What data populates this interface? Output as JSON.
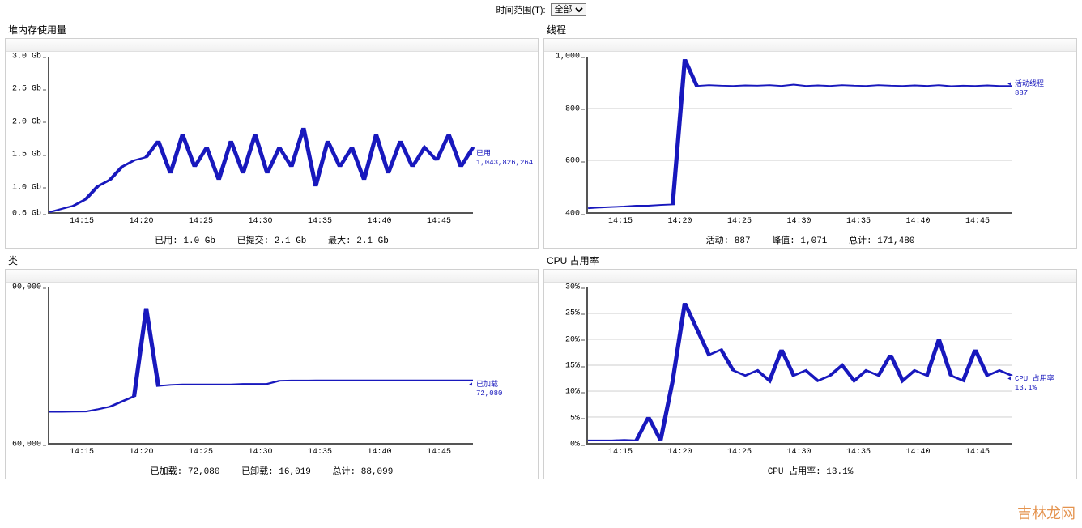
{
  "time_range_label": "时间范围(T):",
  "time_range_value": "全部",
  "watermark": "吉林龙网",
  "x_labels": [
    "14:15",
    "14:20",
    "14:25",
    "14:30",
    "14:35",
    "14:40",
    "14:45"
  ],
  "panels": {
    "heap": {
      "title": "堆内存使用量",
      "y_ticks": [
        "0.6 Gb",
        "1.0 Gb",
        "1.5 Gb",
        "2.0 Gb",
        "2.5 Gb",
        "3.0 Gb"
      ],
      "series_label_name": "已用",
      "series_label_value": "1,043,826,264",
      "summary": {
        "used": "已用:  1.0  Gb",
        "committed": "已提交:  2.1  Gb",
        "max": "最大:  2.1  Gb"
      }
    },
    "threads": {
      "title": "线程",
      "y_ticks": [
        "400",
        "600",
        "800",
        "1,000"
      ],
      "series_label_name": "活动线程",
      "series_label_value": "887",
      "summary": {
        "active": "活动:  887",
        "peak": "峰值:  1,071",
        "total": "总计:  171,480"
      }
    },
    "classes": {
      "title": "类",
      "y_ticks": [
        "60,000",
        "90,000"
      ],
      "series_label_name": "已加载",
      "series_label_value": "72,080",
      "summary": {
        "loaded": "已加载:  72,080",
        "unloaded": "已卸载:  16,019",
        "total": "总计:  88,099"
      }
    },
    "cpu": {
      "title": "CPU 占用率",
      "y_ticks": [
        "0%",
        "5%",
        "10%",
        "15%",
        "20%",
        "25%",
        "30%"
      ],
      "series_label_name": "CPU 占用率",
      "series_label_value": "13.1%",
      "summary": {
        "usage": "CPU 占用率:  13.1%"
      }
    }
  },
  "chart_data": [
    {
      "id": "heap",
      "type": "line",
      "title": "堆内存使用量",
      "xlabel": "",
      "ylabel": "",
      "ylim_gb": [
        0.6,
        3.0
      ],
      "x": [
        "14:12",
        "14:13",
        "14:14",
        "14:15",
        "14:16",
        "14:17",
        "14:18",
        "14:19",
        "14:20",
        "14:21",
        "14:22",
        "14:23",
        "14:24",
        "14:25",
        "14:26",
        "14:27",
        "14:28",
        "14:29",
        "14:30",
        "14:31",
        "14:32",
        "14:33",
        "14:34",
        "14:35",
        "14:36",
        "14:37",
        "14:38",
        "14:39",
        "14:40",
        "14:41",
        "14:42",
        "14:43",
        "14:44",
        "14:45",
        "14:46",
        "14:47"
      ],
      "series": [
        {
          "name": "已用 (bytes)",
          "values_gb": [
            0.6,
            0.65,
            0.7,
            0.8,
            1.0,
            1.1,
            1.3,
            1.4,
            1.45,
            1.7,
            1.2,
            1.8,
            1.3,
            1.6,
            1.1,
            1.7,
            1.2,
            1.8,
            1.2,
            1.6,
            1.3,
            1.9,
            1.0,
            1.7,
            1.3,
            1.6,
            1.1,
            1.8,
            1.2,
            1.7,
            1.3,
            1.6,
            1.4,
            1.8,
            1.3,
            1.6
          ],
          "current_bytes": 1043826264
        }
      ],
      "summary": {
        "used_gb": 1.0,
        "committed_gb": 2.1,
        "max_gb": 2.1
      }
    },
    {
      "id": "threads",
      "type": "line",
      "title": "线程",
      "ylim": [
        400,
        1000
      ],
      "x": [
        "14:12",
        "14:13",
        "14:14",
        "14:15",
        "14:16",
        "14:17",
        "14:18",
        "14:19",
        "14:20",
        "14:21",
        "14:22",
        "14:23",
        "14:24",
        "14:25",
        "14:26",
        "14:27",
        "14:28",
        "14:29",
        "14:30",
        "14:31",
        "14:32",
        "14:33",
        "14:34",
        "14:35",
        "14:36",
        "14:37",
        "14:38",
        "14:39",
        "14:40",
        "14:41",
        "14:42",
        "14:43",
        "14:44",
        "14:45",
        "14:46",
        "14:47"
      ],
      "series": [
        {
          "name": "活动线程",
          "values": [
            415,
            418,
            420,
            422,
            425,
            425,
            428,
            430,
            990,
            887,
            890,
            888,
            887,
            889,
            888,
            890,
            887,
            892,
            887,
            889,
            887,
            890,
            888,
            887,
            890,
            888,
            887,
            889,
            887,
            890,
            886,
            888,
            887,
            889,
            887,
            887
          ],
          "current": 887
        }
      ],
      "summary": {
        "active": 887,
        "peak": 1071,
        "total_started": 171480
      }
    },
    {
      "id": "classes",
      "type": "line",
      "title": "类",
      "ylim": [
        60000,
        90000
      ],
      "x": [
        "14:12",
        "14:13",
        "14:14",
        "14:15",
        "14:16",
        "14:17",
        "14:18",
        "14:19",
        "14:20",
        "14:21",
        "14:22",
        "14:23",
        "14:24",
        "14:25",
        "14:26",
        "14:27",
        "14:28",
        "14:29",
        "14:30",
        "14:31",
        "14:32",
        "14:33",
        "14:34",
        "14:35",
        "14:36",
        "14:37",
        "14:38",
        "14:39",
        "14:40",
        "14:41",
        "14:42",
        "14:43",
        "14:44",
        "14:45",
        "14:46",
        "14:47"
      ],
      "series": [
        {
          "name": "已加载",
          "values": [
            66000,
            66000,
            66050,
            66060,
            66500,
            67000,
            68000,
            69000,
            86000,
            71000,
            71200,
            71300,
            71300,
            71300,
            71300,
            71300,
            71400,
            71400,
            71400,
            72000,
            72050,
            72060,
            72070,
            72080,
            72080,
            72080,
            72080,
            72080,
            72080,
            72080,
            72080,
            72080,
            72080,
            72080,
            72080,
            72080
          ],
          "current": 72080
        }
      ],
      "summary": {
        "loaded": 72080,
        "unloaded": 16019,
        "total": 88099
      }
    },
    {
      "id": "cpu",
      "type": "line",
      "title": "CPU 占用率",
      "ylim_pct": [
        0,
        30
      ],
      "x": [
        "14:12",
        "14:13",
        "14:14",
        "14:15",
        "14:16",
        "14:17",
        "14:18",
        "14:19",
        "14:20",
        "14:21",
        "14:22",
        "14:23",
        "14:24",
        "14:25",
        "14:26",
        "14:27",
        "14:28",
        "14:29",
        "14:30",
        "14:31",
        "14:32",
        "14:33",
        "14:34",
        "14:35",
        "14:36",
        "14:37",
        "14:38",
        "14:39",
        "14:40",
        "14:41",
        "14:42",
        "14:43",
        "14:44",
        "14:45",
        "14:46",
        "14:47"
      ],
      "series": [
        {
          "name": "CPU 占用率 %",
          "values": [
            0.5,
            0.5,
            0.5,
            0.6,
            0.5,
            5,
            0.5,
            12,
            27,
            22,
            17,
            18,
            14,
            13,
            14,
            12,
            18,
            13,
            14,
            12,
            13,
            15,
            12,
            14,
            13,
            17,
            12,
            14,
            13,
            20,
            13,
            12,
            18,
            13,
            14,
            13
          ],
          "current": 13.1
        }
      ],
      "summary": {
        "usage_pct": 13.1
      }
    }
  ]
}
